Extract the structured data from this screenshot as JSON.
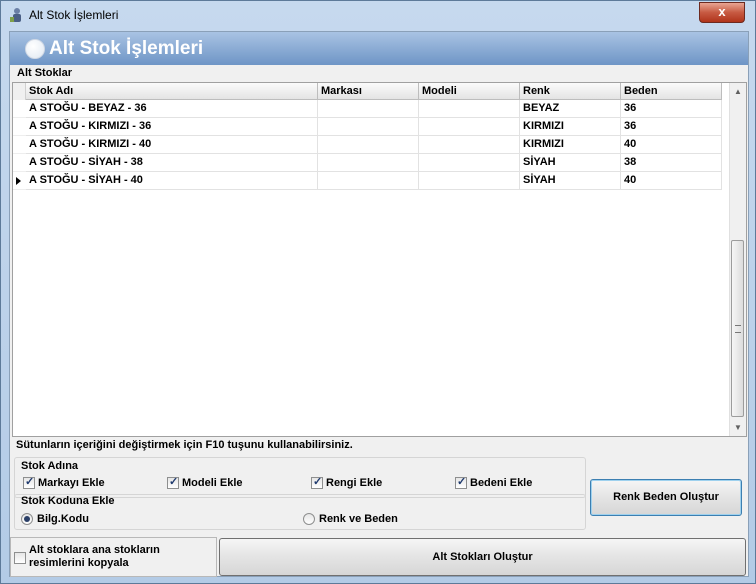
{
  "window": {
    "title": "Alt Stok İşlemleri",
    "close_label": "x"
  },
  "header": {
    "title": "Alt Stok İşlemleri"
  },
  "grid": {
    "section_label": "Alt Stoklar",
    "columns": [
      "Stok Adı",
      "Markası",
      "Modeli",
      "Renk",
      "Beden"
    ],
    "rows": [
      [
        "A STOĞU - BEYAZ - 36",
        "",
        "",
        "BEYAZ",
        "36"
      ],
      [
        "A STOĞU - KIRMIZI - 36",
        "",
        "",
        "KIRMIZI",
        "36"
      ],
      [
        "A STOĞU - KIRMIZI - 40",
        "",
        "",
        "KIRMIZI",
        "40"
      ],
      [
        "A STOĞU - SİYAH - 38",
        "",
        "",
        "SİYAH",
        "38"
      ],
      [
        "A STOĞU - SİYAH - 40",
        "",
        "",
        "SİYAH",
        "40"
      ]
    ],
    "current_row": 4
  },
  "hint": "Sütunların içeriğini değiştirmek için F10 tuşunu kullanabilirsiniz.",
  "stok_adina": {
    "label": "Stok Adına",
    "options": [
      {
        "label": "Markayı Ekle",
        "checked": true
      },
      {
        "label": "Modeli Ekle",
        "checked": true
      },
      {
        "label": "Rengi Ekle",
        "checked": true
      },
      {
        "label": "Bedeni Ekle",
        "checked": true
      }
    ]
  },
  "stok_koduna": {
    "label": "Stok Koduna Ekle",
    "options": [
      {
        "label": "Bilg.Kodu",
        "selected": true
      },
      {
        "label": "Renk ve Beden",
        "selected": false
      }
    ]
  },
  "buttons": {
    "renk_beden": "Renk Beden Oluştur",
    "alt_stoklari": "Alt Stokları Oluştur"
  },
  "copy_images": {
    "label_line1": "Alt stoklara ana stokların",
    "label_line2": "resimlerini kopyala",
    "checked": false
  }
}
